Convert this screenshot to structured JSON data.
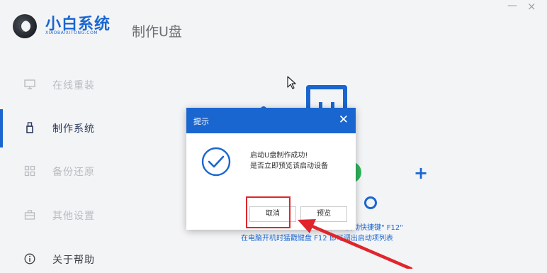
{
  "header": {
    "brand_name": "小白系统",
    "brand_sub": "XIAOBAIXITONG.COM",
    "page_title": "制作U盘",
    "minimize_glyph": "—",
    "close_glyph": "×"
  },
  "sidebar": {
    "items": [
      {
        "label": "在线重装",
        "icon": "monitor-icon"
      },
      {
        "label": "制作系统",
        "icon": "usb-icon"
      },
      {
        "label": "备份还原",
        "icon": "grid-icon"
      },
      {
        "label": "其他设置",
        "icon": "briefcase-icon"
      },
      {
        "label": "关于帮助",
        "icon": "info-icon"
      }
    ],
    "active_index": 1
  },
  "background": {
    "hint_line1": "启动快捷键\" F12\"",
    "hint_line2": "在电脑开机时猛戳键盘 F12 即可调出启动项列表"
  },
  "dialog": {
    "title": "提示",
    "close_glyph": "✕",
    "message_line1": "启动U盘制作成功!",
    "message_line2": "是否立即预览该启动设备",
    "cancel_label": "取消",
    "preview_label": "预览"
  },
  "colors": {
    "accent": "#1a66d0",
    "highlight": "#e0262c",
    "success_green": "#2eb35a"
  }
}
